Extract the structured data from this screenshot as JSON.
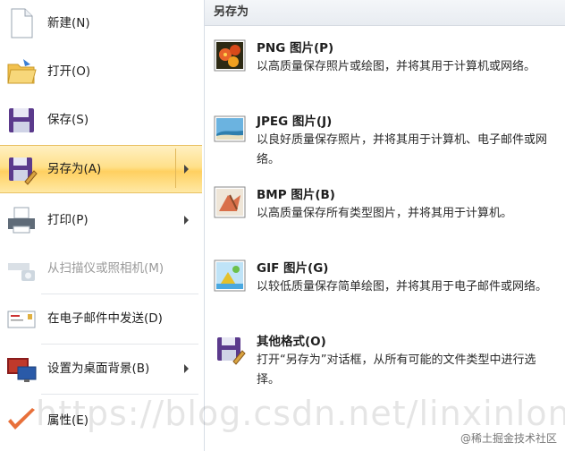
{
  "left_menu": {
    "items": [
      {
        "label": "新建(N)",
        "icon": "new-document-icon",
        "enabled": true,
        "has_submenu": false
      },
      {
        "label": "打开(O)",
        "icon": "open-folder-icon",
        "enabled": true,
        "has_submenu": false
      },
      {
        "label": "保存(S)",
        "icon": "save-floppy-icon",
        "enabled": true,
        "has_submenu": false
      },
      {
        "label": "另存为(A)",
        "icon": "save-as-icon",
        "enabled": true,
        "has_submenu": true,
        "active": true
      },
      {
        "label": "打印(P)",
        "icon": "printer-icon",
        "enabled": true,
        "has_submenu": true
      },
      {
        "label": "从扫描仪或照相机(M)",
        "icon": "scanner-camera-icon",
        "enabled": false,
        "has_submenu": false
      },
      {
        "label": "在电子邮件中发送(D)",
        "icon": "email-icon",
        "enabled": true,
        "has_submenu": false
      },
      {
        "label": "设置为桌面背景(B)",
        "icon": "desktop-background-icon",
        "enabled": true,
        "has_submenu": true
      },
      {
        "label": "属性(E)",
        "icon": "checkmark-icon",
        "enabled": true,
        "has_submenu": false
      }
    ]
  },
  "submenu": {
    "header": "另存为",
    "items": [
      {
        "title": "PNG 图片(P)",
        "description": "以高质量保存照片或绘图，并将其用于计算机或网络。",
        "icon": "png-image-icon"
      },
      {
        "title": "JPEG 图片(J)",
        "description": "以良好质量保存照片，并将其用于计算机、电子邮件或网络。",
        "icon": "jpeg-image-icon"
      },
      {
        "title": "BMP 图片(B)",
        "description": "以高质量保存所有类型图片，并将其用于计算机。",
        "icon": "bmp-image-icon"
      },
      {
        "title": "GIF 图片(G)",
        "description": "以较低质量保存简单绘图，并将其用于电子邮件或网络。",
        "icon": "gif-image-icon"
      },
      {
        "title": "其他格式(O)",
        "description": "打开“另存为”对话框，从所有可能的文件类型中进行选择。",
        "icon": "other-formats-icon"
      }
    ]
  },
  "watermark": "https://blog.csdn.net/linxinloningg",
  "credit": "@稀土掘金技术社区",
  "colors": {
    "highlight_top": "#fff0c2",
    "highlight_mid": "#ffd060",
    "highlight_border": "#e9c063"
  }
}
